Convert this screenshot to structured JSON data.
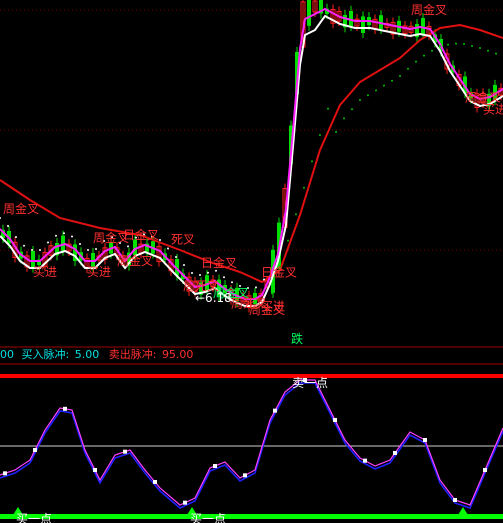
{
  "indicator_bar": {
    "prev_value": "00",
    "buy_label": "买入脉冲:",
    "buy_value": "5.00",
    "sell_label": "卖出脉冲:",
    "sell_value": "95.00"
  },
  "colors": {
    "background": "#000000",
    "up_candle": "#ff2020",
    "down_candle": "#00e000",
    "ma_red": "#e01010",
    "ma_white": "#ffffff",
    "ma_magenta": "#ff20ff",
    "dots": "#00c000",
    "osc_blue": "#2020ff",
    "osc_magenta": "#ff40ff",
    "signal_green": "#00ff00",
    "signal_red": "#ff0000",
    "label_red": "#ff3030",
    "label_green": "#00ff60",
    "info_cyan": "#00e0e0",
    "info_red": "#ff3030"
  },
  "chart_data": [
    {
      "type": "candlestick",
      "title": "",
      "annotations": [
        {
          "text": "周金叉",
          "color": "red",
          "idx": 0,
          "pos": "above"
        },
        {
          "text": "买进",
          "color": "red",
          "idx": 5,
          "pos": "below"
        },
        {
          "text": "买进",
          "color": "red",
          "idx": 14,
          "pos": "below"
        },
        {
          "text": "周金叉",
          "color": "red",
          "idx": 15,
          "pos": "above"
        },
        {
          "text": "日金叉",
          "color": "red",
          "idx": 20,
          "pos": "above"
        },
        {
          "text": "周金叉",
          "color": "red",
          "idx": 19,
          "pos": "below"
        },
        {
          "text": "死叉",
          "color": "red",
          "idx": 28,
          "pos": "above"
        },
        {
          "text": "日金叉",
          "color": "red",
          "idx": 33,
          "pos": "above"
        },
        {
          "text": "周金叉",
          "color": "green",
          "idx": 35,
          "pos": "below"
        },
        {
          "text": "周死叉",
          "color": "red",
          "idx": 30,
          "pos": "below"
        },
        {
          "text": "周死叉",
          "color": "red",
          "idx": 38,
          "pos": "below"
        },
        {
          "text": "←6.18",
          "color": "white",
          "idx": 32,
          "pos": "below"
        },
        {
          "text": "买进",
          "color": "red",
          "idx": 43,
          "pos": "below"
        },
        {
          "text": "周金叉",
          "color": "red",
          "idx": 41,
          "pos": "below"
        },
        {
          "text": "日金叉",
          "color": "red",
          "idx": 43,
          "pos": "above"
        },
        {
          "text": "跌",
          "color": "green",
          "idx": 48,
          "pos": "bottom"
        },
        {
          "text": "周金叉",
          "color": "red",
          "idx": 68,
          "pos": "above"
        },
        {
          "text": "周金叉",
          "color": "red",
          "idx": 77,
          "pos": "below"
        },
        {
          "text": "买进",
          "color": "red",
          "idx": 80,
          "pos": "below"
        }
      ]
    },
    {
      "type": "line",
      "title": "",
      "ylim": [
        0,
        100
      ],
      "levels": [
        5,
        50,
        95
      ],
      "annotations": [
        {
          "text": "卖一点",
          "color": "white",
          "idx": 51
        },
        {
          "text": "买一点",
          "color": "white",
          "idx": 3
        },
        {
          "text": "买一点",
          "color": "white",
          "idx": 32
        }
      ]
    }
  ]
}
